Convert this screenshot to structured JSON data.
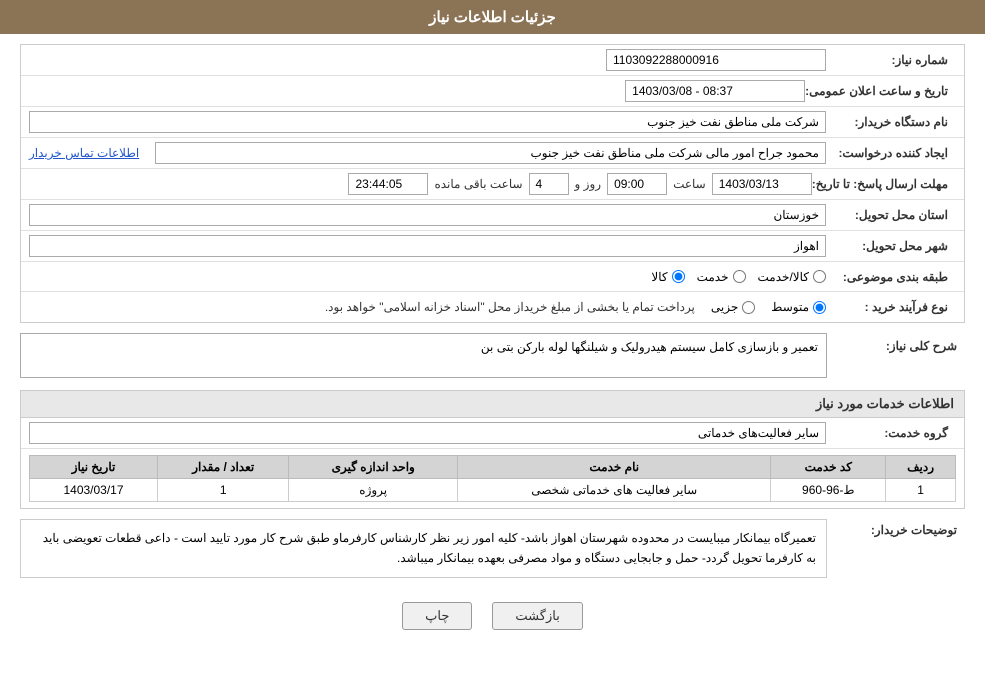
{
  "header": {
    "title": "جزئیات اطلاعات نیاز"
  },
  "fields": {
    "need_number_label": "شماره نیاز:",
    "need_number_value": "1103092288000916",
    "org_name_label": "نام دستگاه خریدار:",
    "org_name_value": "شرکت ملی مناطق نفت خیز جنوب",
    "created_by_label": "ایجاد کننده درخواست:",
    "created_by_value": "محمود جراح امور مالی شرکت ملی مناطق نفت خیز جنوب",
    "contact_link": "اطلاعات تماس خریدار",
    "announce_datetime_label": "تاریخ و ساعت اعلان عمومی:",
    "announce_datetime_value": "1403/03/08 - 08:37",
    "reply_deadline_label": "مهلت ارسال پاسخ: تا تاریخ:",
    "reply_date_value": "1403/03/13",
    "reply_time_label": "ساعت",
    "reply_time_value": "09:00",
    "reply_days_label": "روز و",
    "reply_days_value": "4",
    "remaining_label": "ساعت باقی مانده",
    "remaining_value": "23:44:05",
    "province_label": "استان محل تحویل:",
    "province_value": "خوزستان",
    "city_label": "شهر محل تحویل:",
    "city_value": "اهواز",
    "category_label": "طبقه بندی موضوعی:",
    "category_options": [
      "کالا",
      "خدمت",
      "کالا/خدمت"
    ],
    "category_selected": "کالا",
    "purchase_type_label": "نوع فرآیند خرید :",
    "purchase_options": [
      "جزیی",
      "متوسط"
    ],
    "purchase_selected": "متوسط",
    "purchase_desc": "پرداخت تمام یا بخشی از مبلغ خریداز محل \"اسناد خزانه اسلامی\" خواهد بود.",
    "need_desc_label": "شرح کلی نیاز:",
    "need_desc_value": "تعمیر و بازسازی کامل سیستم هیدرولیک و شیلنگها لوله بارکن بتی بن",
    "services_section_title": "اطلاعات خدمات مورد نیاز",
    "service_group_label": "گروه خدمت:",
    "service_group_value": "سایر فعالیت‌های خدماتی",
    "table": {
      "columns": [
        "ردیف",
        "کد خدمت",
        "نام خدمت",
        "واحد اندازه گیری",
        "تعداد / مقدار",
        "تاریخ نیاز"
      ],
      "rows": [
        {
          "row": "1",
          "code": "ط-96-960",
          "name": "سایر فعالیت های خدماتی شخصی",
          "unit": "پروژه",
          "qty": "1",
          "date": "1403/03/17"
        }
      ]
    },
    "buyer_notes_label": "توضیحات خریدار:",
    "buyer_notes_value": "تعمیرگاه بیمانکار میبایست در محدوده شهرستان اهواز باشد- کلیه امور زیر نظر کارشناس کارفرماو طبق شرح کار مورد تایید است - داعی قطعات تعویضی باید به کارفرما تحویل گردد- حمل و جابجایی دستگاه و مواد مصرفی بعهده بیمانکار میباشد."
  },
  "buttons": {
    "print_label": "چاپ",
    "back_label": "بازگشت"
  }
}
